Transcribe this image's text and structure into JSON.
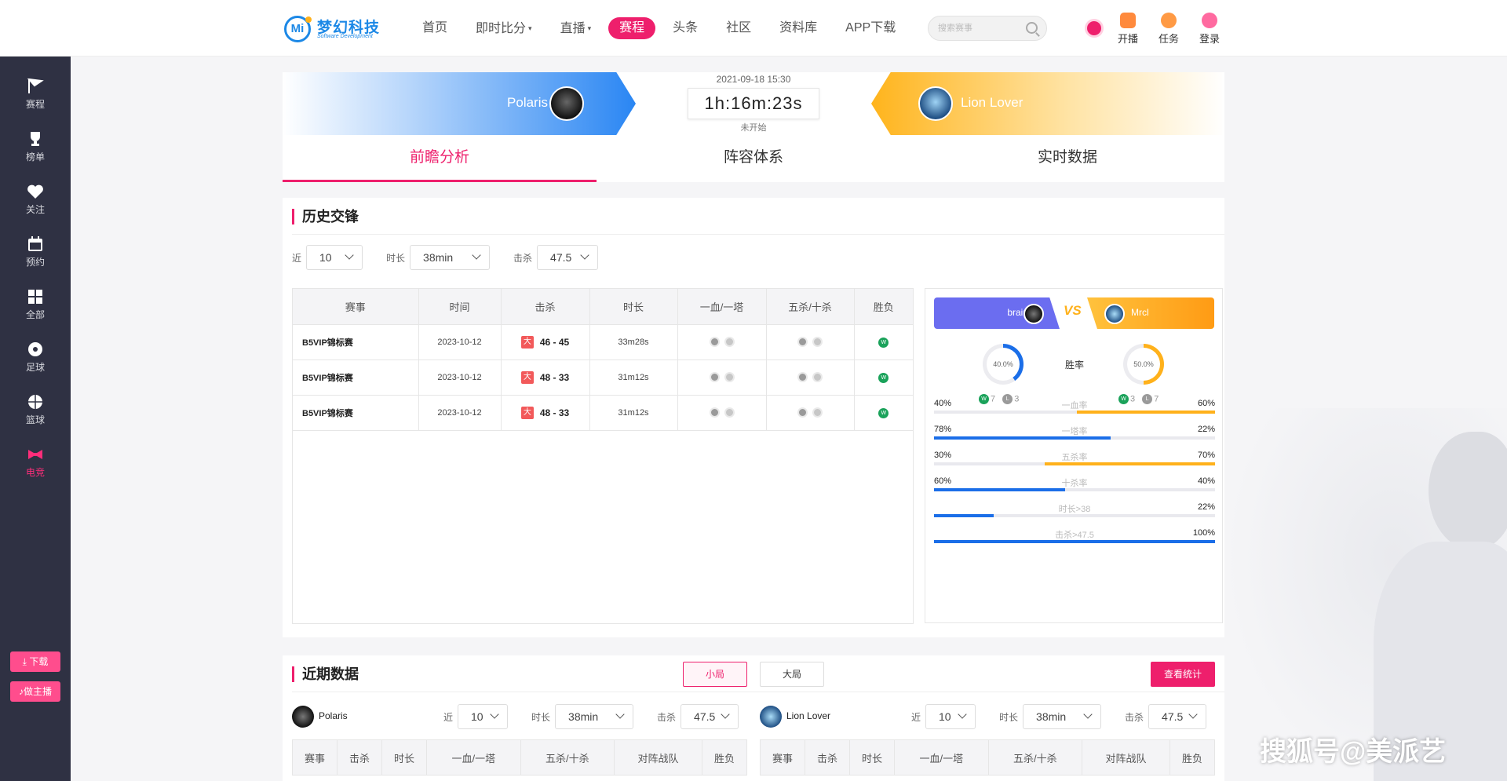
{
  "brand": {
    "name": "梦幻科技",
    "sub": "Software Development",
    "mark": "Mi"
  },
  "nav": [
    {
      "label": "首页"
    },
    {
      "label": "即时比分",
      "caret": "▾"
    },
    {
      "label": "直播",
      "caret": "▾"
    },
    {
      "label": "赛程"
    },
    {
      "label": "头条"
    },
    {
      "label": "社区"
    },
    {
      "label": "资料库"
    },
    {
      "label": "APP下载"
    }
  ],
  "search": {
    "placeholder": "搜索赛事"
  },
  "tools": {
    "live": "开播",
    "task": "任务",
    "login": "登录"
  },
  "sidebar": {
    "items": [
      {
        "label": "赛程"
      },
      {
        "label": "榜单"
      },
      {
        "label": "关注"
      },
      {
        "label": "预约"
      },
      {
        "label": "全部"
      },
      {
        "label": "足球"
      },
      {
        "label": "篮球"
      },
      {
        "label": "电竞"
      }
    ],
    "download": "下载",
    "anchor": "做主播"
  },
  "match": {
    "datetime": "2021-09-18 15:30",
    "countdown": "1h:16m:23s",
    "status": "未开始",
    "home": "Polaris",
    "away": "Lion Lover"
  },
  "tabs": [
    "前瞻分析",
    "阵容体系",
    "实时数据"
  ],
  "history": {
    "title": "历史交锋",
    "filters": {
      "recent_label": "近",
      "recent": "10",
      "duration_label": "时长",
      "duration": "38min",
      "kills_label": "击杀",
      "kills": "47.5"
    },
    "columns": [
      "赛事",
      "时间",
      "击杀",
      "时长",
      "一血/一塔",
      "五杀/十杀",
      "胜负"
    ],
    "rows": [
      {
        "event": "B5VIP锦标赛",
        "date": "2023-10-12",
        "tag": "大",
        "kills": "46 - 45",
        "duration": "33m28s",
        "result": "W"
      },
      {
        "event": "B5VIP锦标赛",
        "date": "2023-10-12",
        "tag": "大",
        "kills": "48 - 33",
        "duration": "31m12s",
        "result": "W"
      },
      {
        "event": "B5VIP锦标赛",
        "date": "2023-10-12",
        "tag": "大",
        "kills": "48 - 33",
        "duration": "31m12s",
        "result": "W"
      }
    ]
  },
  "compare": {
    "left": "brain",
    "right": "Mrcl",
    "vs": "VS",
    "winrate_label": "胜率",
    "left_rate": "40.0%",
    "right_rate": "50.0%",
    "left_rate_value": 0.4,
    "right_rate_value": 0.5,
    "left_w": "7",
    "left_l": "3",
    "right_w": "3",
    "right_l": "7",
    "w_mark": "W",
    "l_mark": "L",
    "stats": [
      {
        "name": "一血率",
        "left": "40%",
        "right": "60%",
        "lv": 0,
        "rv": 0.492
      },
      {
        "name": "一塔率",
        "left": "78%",
        "right": "22%",
        "lv": 0.628,
        "rv": 0
      },
      {
        "name": "五杀率",
        "left": "30%",
        "right": "70%",
        "lv": 0,
        "rv": 0.606
      },
      {
        "name": "十杀率",
        "left": "60%",
        "right": "40%",
        "lv": 0.466,
        "rv": 0
      },
      {
        "name": "时长>38",
        "left": "",
        "right": "22%",
        "lv": 0.212,
        "rv": 0
      },
      {
        "name": "击杀>47.5",
        "left": "",
        "right": "100%",
        "lv": 1,
        "rv": 0
      }
    ]
  },
  "recent": {
    "title": "近期数据",
    "tab_small": "小局",
    "tab_big": "大局",
    "stats_button": "查看统计",
    "left_team": "Polaris",
    "right_team": "Lion Lover",
    "filters": {
      "recent_label": "近",
      "recent": "10",
      "duration_label": "时长",
      "duration": "38min",
      "kills_label": "击杀",
      "kills": "47.5"
    },
    "columns": [
      "赛事",
      "击杀",
      "时长",
      "一血/一塔",
      "五杀/十杀",
      "对阵战队",
      "胜负"
    ]
  },
  "watermark": "搜狐号@美派艺",
  "colors": {
    "accent": "#ee1f6c",
    "blue": "#1b6ee8",
    "orange": "#ffb11b",
    "sidebar": "#2f3143"
  }
}
